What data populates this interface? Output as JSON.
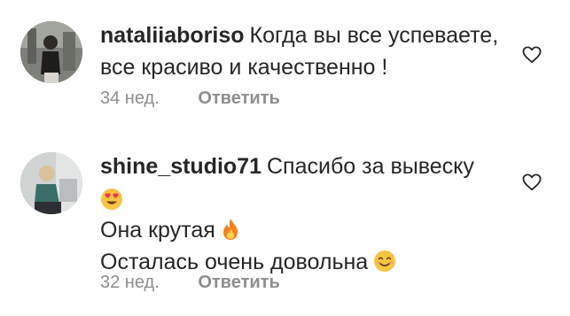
{
  "comments": [
    {
      "username": "nataliiaboriso",
      "text_lines": [
        "Когда вы все успеваете,",
        "все красиво и качественно !"
      ],
      "time": "34 нед.",
      "reply_label": "Ответить",
      "avatar_icon": "user-avatar-icon",
      "like_icon": "heart-outline-icon"
    },
    {
      "username": "shine_studio71",
      "text_lines": [
        "Спасибо за вывеску",
        "",
        "Она крутая",
        "Осталась очень довольна"
      ],
      "emojis": [
        "heart-eyes-emoji",
        "fire-emoji",
        "smiling-emoji"
      ],
      "time": "32 нед.",
      "reply_label": "Ответить",
      "avatar_icon": "user-avatar-icon",
      "like_icon": "heart-outline-icon"
    }
  ],
  "colors": {
    "text": "#262626",
    "secondary": "#8e8e8e",
    "background": "#ffffff"
  }
}
